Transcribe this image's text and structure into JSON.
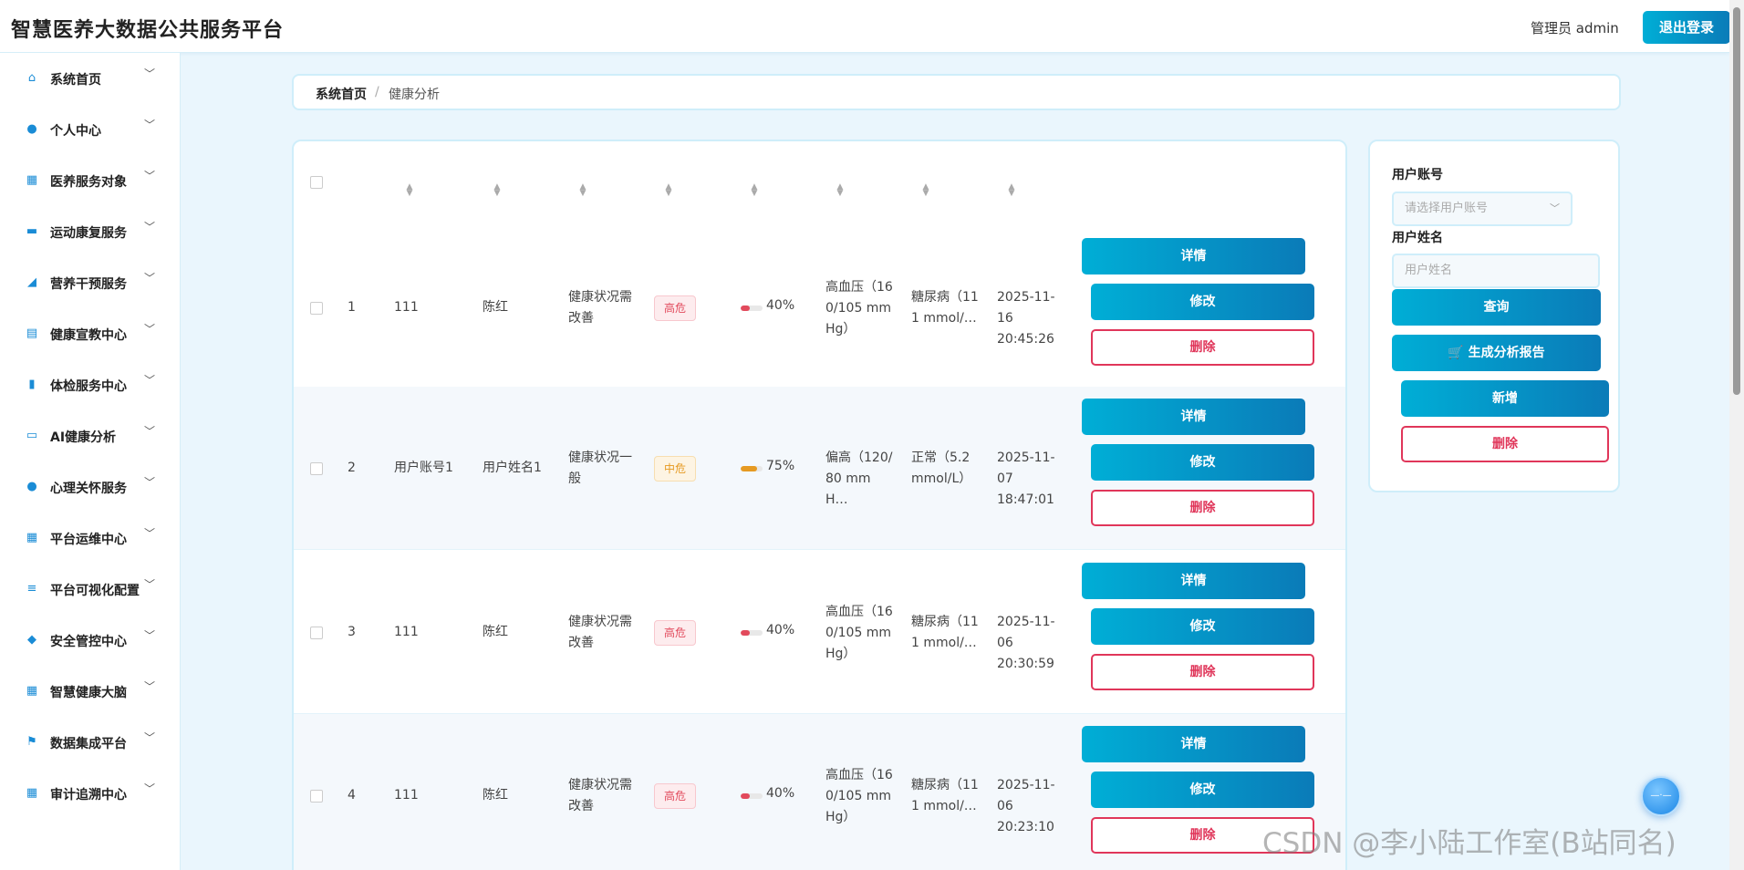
{
  "header": {
    "app_title": "智慧医养大数据公共服务平台",
    "admin_label": "管理员 admin",
    "logout_label": "退出登录"
  },
  "sidebar": {
    "items": [
      {
        "label": "系统首页",
        "icon": "home-icon"
      },
      {
        "label": "个人中心",
        "icon": "user-icon"
      },
      {
        "label": "医养服务对象",
        "icon": "grid-icon"
      },
      {
        "label": "运动康复服务",
        "icon": "chat-icon"
      },
      {
        "label": "营养干预服务",
        "icon": "thumb-icon"
      },
      {
        "label": "健康宣教中心",
        "icon": "clipboard-icon"
      },
      {
        "label": "体检服务中心",
        "icon": "bar-chart-icon"
      },
      {
        "label": "AI健康分析",
        "icon": "monitor-icon"
      },
      {
        "label": "心理关怀服务",
        "icon": "user-icon"
      },
      {
        "label": "平台运维中心",
        "icon": "grid-icon"
      },
      {
        "label": "平台可视化配置",
        "icon": "sliders-icon"
      },
      {
        "label": "安全管控中心",
        "icon": "shield-icon"
      },
      {
        "label": "智慧健康大脑",
        "icon": "grid-icon"
      },
      {
        "label": "数据集成平台",
        "icon": "flag-icon"
      },
      {
        "label": "审计追溯中心",
        "icon": "grid-icon"
      }
    ]
  },
  "breadcrumb": {
    "home": "系统首页",
    "separator": "/",
    "current": "健康分析"
  },
  "table": {
    "rows": [
      {
        "index": "1",
        "account": "111",
        "name": "陈红",
        "status": "健康状况需改善",
        "risk": "高危",
        "risk_level": "high",
        "progress": 0.4,
        "progress_label": "40%",
        "blood_pressure": "高血压（160/105 mmHg）",
        "blood_sugar": "糖尿病（111 mmol/…",
        "time": "2025-11-16 20:45:26"
      },
      {
        "index": "2",
        "account": "用户账号1",
        "name": "用户姓名1",
        "status": "健康状况一般",
        "risk": "中危",
        "risk_level": "mid",
        "progress": 0.75,
        "progress_label": "75%",
        "blood_pressure": "偏高（120/80 mmH…",
        "blood_sugar": "正常（5.2 mmol/L）",
        "time": "2025-11-07 18:47:01"
      },
      {
        "index": "3",
        "account": "111",
        "name": "陈红",
        "status": "健康状况需改善",
        "risk": "高危",
        "risk_level": "high",
        "progress": 0.4,
        "progress_label": "40%",
        "blood_pressure": "高血压（160/105 mmHg）",
        "blood_sugar": "糖尿病（111 mmol/…",
        "time": "2025-11-06 20:30:59"
      },
      {
        "index": "4",
        "account": "111",
        "name": "陈红",
        "status": "健康状况需改善",
        "risk": "高危",
        "risk_level": "high",
        "progress": 0.4,
        "progress_label": "40%",
        "blood_pressure": "高血压（160/105 mmHg）",
        "blood_sugar": "糖尿病（111 mmol/…",
        "time": "2025-11-06 20:23:10"
      }
    ],
    "actions": {
      "detail": "详情",
      "edit": "修改",
      "delete": "删除"
    }
  },
  "search": {
    "account_label": "用户账号",
    "account_placeholder": "请选择用户账号",
    "name_label": "用户姓名",
    "name_placeholder": "用户姓名",
    "query_label": "查询",
    "report_label": "生成分析报告",
    "add_label": "新增",
    "delete_label": "删除"
  },
  "watermark": "CSDN @李小陆工作室(B站同名)",
  "colors": {
    "accent_start": "#00aed6",
    "accent_end": "#0a7bb8",
    "danger": "#e0365a",
    "risk_high": "#e24a5c",
    "risk_mid": "#e69a22"
  }
}
